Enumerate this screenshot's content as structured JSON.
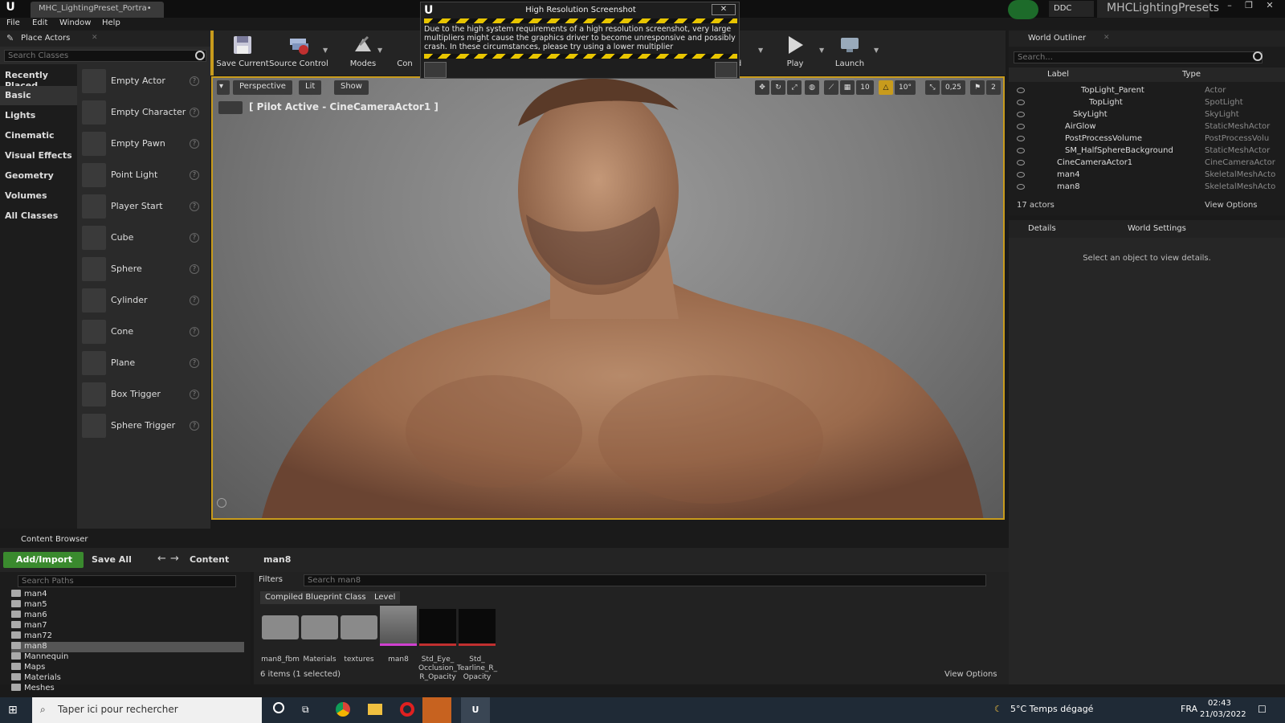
{
  "titlebar": {
    "doc_tab": "MHC_LightingPreset_Portra•",
    "ddc": "DDC",
    "project": "MHCLightingPresets"
  },
  "menu": [
    "File",
    "Edit",
    "Window",
    "Help"
  ],
  "place_actors": {
    "tab": "Place Actors",
    "search_placeholder": "Search Classes",
    "categories": [
      "Recently Placed",
      "Basic",
      "Lights",
      "Cinematic",
      "Visual Effects",
      "Geometry",
      "Volumes",
      "All Classes"
    ],
    "actors": [
      "Empty Actor",
      "Empty Character",
      "Empty Pawn",
      "Point Light",
      "Player Start",
      "Cube",
      "Sphere",
      "Cylinder",
      "Cone",
      "Plane",
      "Box Trigger",
      "Sphere Trigger"
    ]
  },
  "toolbar": {
    "save_current": "Save Current",
    "source_control": "Source Control",
    "modes": "Modes",
    "content_partial": "Con",
    "build_partial": "d",
    "play": "Play",
    "launch": "Launch"
  },
  "popup": {
    "title": "High Resolution Screenshot",
    "close": "✕",
    "text": "Due to the high system requirements of a high resolution screenshot, very large multipliers might cause the graphics driver to become unresponsive and possibly crash. In these circumstances, please try using a lower multiplier"
  },
  "viewport": {
    "perspective": "Perspective",
    "lit": "Lit",
    "show": "Show",
    "pilot": "[ Pilot Active - CineCameraActor1 ]",
    "grid_snap": "10",
    "rot_snap": "10°",
    "scale_snap": "0,25",
    "cam_speed": "2"
  },
  "world_outliner": {
    "tab": "World Outliner",
    "search_placeholder": "Search...",
    "col_label": "Label",
    "col_type": "Type",
    "rows": [
      {
        "name": "TopLight_Parent",
        "type": "Actor",
        "indent": 86
      },
      {
        "name": "TopLight",
        "type": "SpotLight",
        "indent": 96
      },
      {
        "name": "SkyLight",
        "type": "SkyLight",
        "indent": 76
      },
      {
        "name": "AirGlow",
        "type": "StaticMeshActor",
        "indent": 66
      },
      {
        "name": "PostProcessVolume",
        "type": "PostProcessVolu",
        "indent": 66
      },
      {
        "name": "SM_HalfSphereBackground",
        "type": "StaticMeshActor",
        "indent": 66
      },
      {
        "name": "CineCameraActor1",
        "type": "CineCameraActor",
        "indent": 56
      },
      {
        "name": "man4",
        "type": "SkeletalMeshActo",
        "indent": 56
      },
      {
        "name": "man8",
        "type": "SkeletalMeshActo",
        "indent": 56
      }
    ],
    "count": "17 actors",
    "view_options": "View Options"
  },
  "details": {
    "tab_details": "Details",
    "tab_world": "World Settings",
    "empty": "Select an object to view details."
  },
  "content_browser": {
    "tab": "Content Browser",
    "add_import": "Add/Import",
    "save_all": "Save All",
    "crumb_root": "Content",
    "crumb_folder": "man8",
    "search_paths": "Search Paths",
    "filters": "Filters",
    "search_assets": "Search man8",
    "filter_tags": [
      "Compiled Blueprint Class",
      "Level"
    ],
    "tree": [
      {
        "label": "man4",
        "selected": false
      },
      {
        "label": "man5",
        "selected": false
      },
      {
        "label": "man6",
        "selected": false
      },
      {
        "label": "man7",
        "selected": false
      },
      {
        "label": "man72",
        "selected": false
      },
      {
        "label": "man8",
        "selected": true
      },
      {
        "label": "Mannequin",
        "selected": false
      },
      {
        "label": "Maps",
        "selected": false
      },
      {
        "label": "Materials",
        "selected": false
      },
      {
        "label": "Meshes",
        "selected": false
      }
    ],
    "assets": [
      {
        "name": "man8_fbm",
        "kind": "folder"
      },
      {
        "name": "Materials",
        "kind": "folder"
      },
      {
        "name": "textures",
        "kind": "folder"
      },
      {
        "name": "man8",
        "kind": "mesh"
      },
      {
        "name": "Std_Eye_ Occlusion_ R_Opacity",
        "kind": "texture"
      },
      {
        "name": "Std_ Tearline_R_ Opacity",
        "kind": "texture"
      }
    ],
    "item_count": "6 items (1 selected)",
    "view_options": "View Options"
  },
  "taskbar": {
    "search": "Taper ici pour rechercher",
    "weather": "5°C  Temps dégagé",
    "lang": "FRA",
    "time": "02:43",
    "date": "21/03/2022"
  },
  "colors": {
    "accent_orange": "#c89b1c",
    "add_green": "#3a8a2e"
  }
}
